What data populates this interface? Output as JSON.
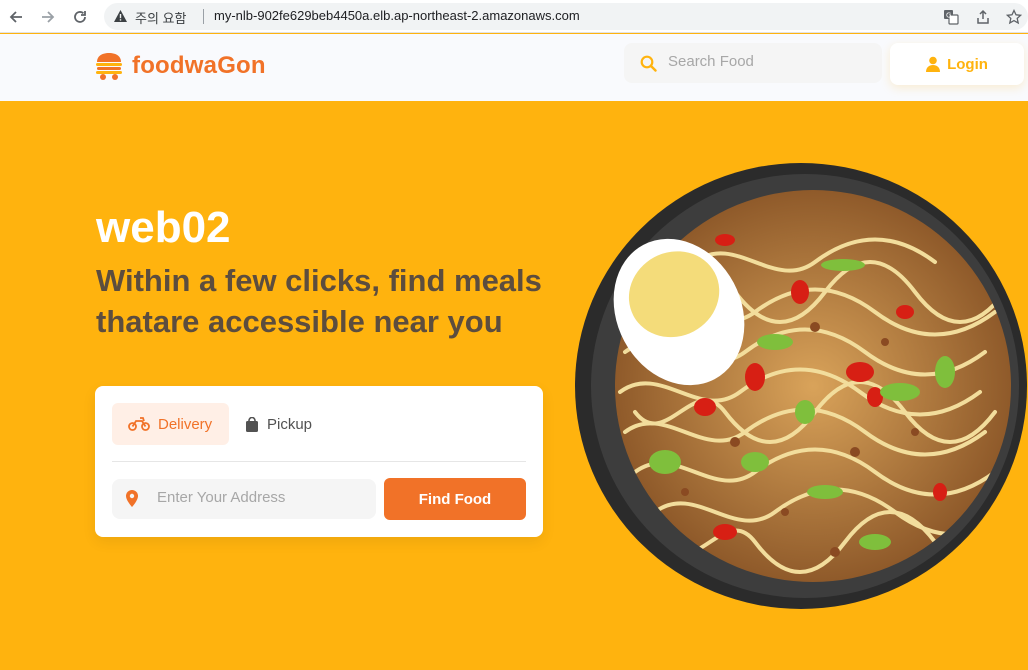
{
  "browser": {
    "security_label": "주의 요함",
    "url": "my-nlb-902fe629beb4450a.elb.ap-northeast-2.amazonaws.com"
  },
  "header": {
    "logo_text": "foodwaGon",
    "search_placeholder": "Search Food",
    "login_label": "Login"
  },
  "hero": {
    "title": "web02",
    "subtitle": "Within a few clicks, find meals thatare accessible near you"
  },
  "order_card": {
    "tabs": [
      {
        "label": "Delivery",
        "icon": "motorcycle-icon",
        "active": true
      },
      {
        "label": "Pickup",
        "icon": "shopping-bag-icon",
        "active": false
      }
    ],
    "address_placeholder": "Enter Your Address",
    "find_button_label": "Find Food"
  },
  "colors": {
    "brand_orange": "#f17228",
    "hero_yellow": "#ffb30e",
    "subtitle_brown": "#5c4d3e",
    "delivery_tab_bg": "#ffefe6"
  }
}
